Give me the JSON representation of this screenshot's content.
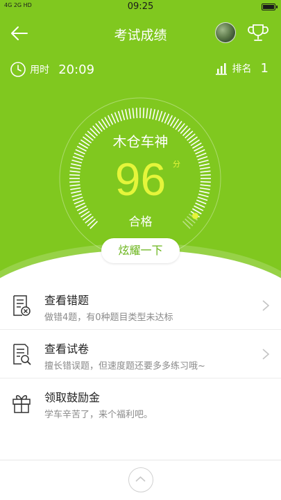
{
  "statusbar": {
    "signal_text": "4G  2G  HD",
    "time": "09:25"
  },
  "nav": {
    "title": "考试成绩"
  },
  "stats": {
    "time_label": "用时",
    "time_value": "20:09",
    "rank_label": "排名",
    "rank_value": "1"
  },
  "score": {
    "name": "木仓车神",
    "value": "96",
    "unit": "分",
    "status": "合格",
    "progress": 0.96
  },
  "share_button": "炫耀一下",
  "actions": [
    {
      "title": "查看错题",
      "subtitle": "做错4题，有0种题目类型未达标",
      "icon": "wrong-questions-icon"
    },
    {
      "title": "查看试卷",
      "subtitle": "擅长错误题，但速度题还要多多练习哦~",
      "icon": "exam-paper-icon"
    },
    {
      "title": "领取鼓励金",
      "subtitle": "学车辛苦了，来个福利吧。",
      "icon": "gift-icon"
    }
  ],
  "colors": {
    "brand_green": "#80c81f",
    "score_yellow": "#e5f53a",
    "button_text": "#6bb51c"
  }
}
